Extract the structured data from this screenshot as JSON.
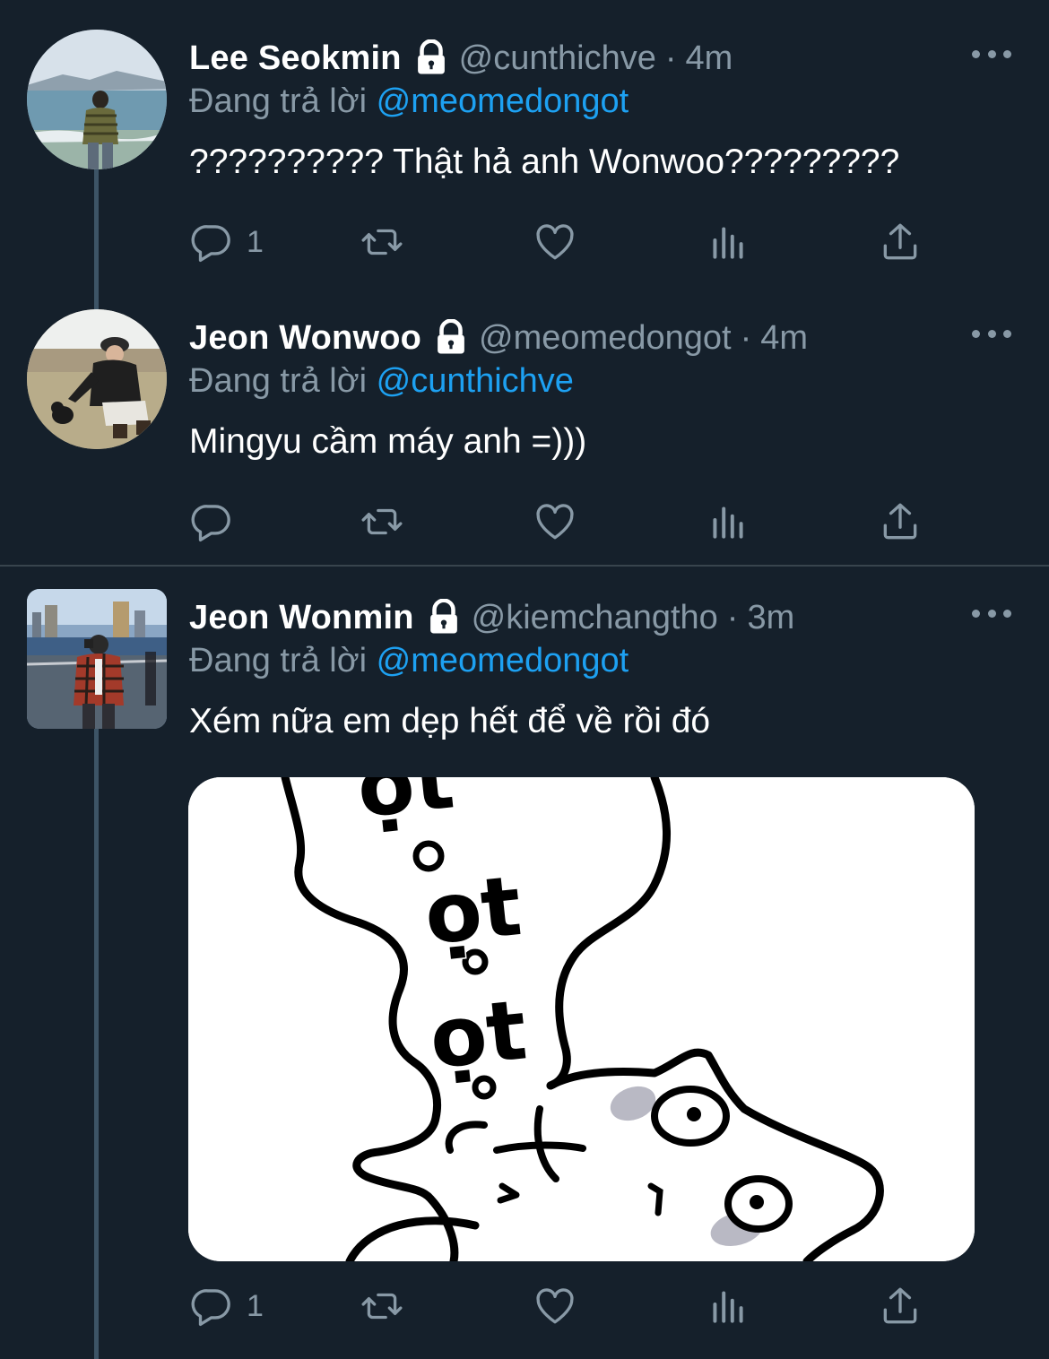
{
  "tweets": [
    {
      "name": "Lee Seokmin",
      "handle": "@cunthichve",
      "dot": "·",
      "time": "4m",
      "replying_prefix": "Đang trả lời ",
      "replying_to": "@meomedongot",
      "text": "?????????? Thật hả anh Wonwoo?????????",
      "reply_count": "1",
      "avatar_icon": "avatar-photo-beach",
      "avatar_shape": "circle"
    },
    {
      "name": "Jeon Wonwoo",
      "handle": "@meomedongot",
      "dot": "·",
      "time": "4m",
      "replying_prefix": "Đang trả lời ",
      "replying_to": "@cunthichve",
      "text": "Mingyu cầm máy anh =)))",
      "reply_count": "",
      "avatar_icon": "avatar-photo-park",
      "avatar_shape": "circle"
    },
    {
      "name": "Jeon Wonmin",
      "handle": "@kiemchangtho",
      "dot": "·",
      "time": "3m",
      "replying_prefix": "Đang trả lời ",
      "replying_to": "@meomedongot",
      "text": "Xém nữa em dẹp hết để về rồi đó",
      "reply_count": "1",
      "avatar_icon": "avatar-photo-city",
      "avatar_shape": "square",
      "media": {
        "type": "sticker",
        "lettering": [
          "ọt",
          "ọt",
          "ọt"
        ]
      }
    }
  ],
  "icons": {
    "lock": "lock-icon",
    "more": "more-icon",
    "reply": "reply-icon",
    "retweet": "retweet-icon",
    "like": "heart-icon",
    "analytics": "analytics-icon",
    "share": "share-icon"
  },
  "colors": {
    "background": "#15202b",
    "secondary_text": "#8899a6",
    "mention": "#1da1f2",
    "thread_line": "#3d5466",
    "separator": "#38444d"
  }
}
